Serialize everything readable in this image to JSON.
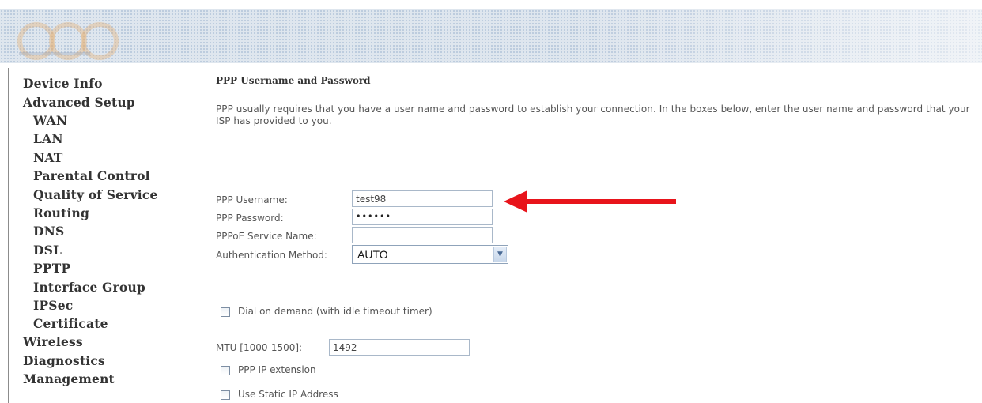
{
  "sidebar": {
    "items": [
      {
        "label": "Device Info",
        "sub": false
      },
      {
        "label": "Advanced Setup",
        "sub": false
      },
      {
        "label": "WAN",
        "sub": true
      },
      {
        "label": "LAN",
        "sub": true
      },
      {
        "label": "NAT",
        "sub": true
      },
      {
        "label": "Parental Control",
        "sub": true
      },
      {
        "label": "Quality of Service",
        "sub": true
      },
      {
        "label": "Routing",
        "sub": true
      },
      {
        "label": "DNS",
        "sub": true
      },
      {
        "label": "DSL",
        "sub": true
      },
      {
        "label": "PPTP",
        "sub": true
      },
      {
        "label": "Interface Group",
        "sub": true
      },
      {
        "label": "IPSec",
        "sub": true
      },
      {
        "label": "Certificate",
        "sub": true
      },
      {
        "label": "Wireless",
        "sub": false
      },
      {
        "label": "Diagnostics",
        "sub": false
      },
      {
        "label": "Management",
        "sub": false
      }
    ]
  },
  "main": {
    "title": "PPP Username and Password",
    "intro": "PPP usually requires that you have a user name and password to establish your connection. In the boxes below, enter the user name and password that your ISP has provided to you.",
    "fields": {
      "username_label": "PPP Username:",
      "username_value": "test98",
      "password_label": "PPP Password:",
      "password_value": "••••••",
      "service_label": "PPPoE Service Name:",
      "service_value": "",
      "auth_label": "Authentication Method:",
      "auth_value": "AUTO"
    },
    "dial_on_demand_label": "Dial on demand (with idle timeout timer)",
    "mtu_label": "MTU [1000-1500]:",
    "mtu_value": "1492",
    "ppp_ip_extension_label": "PPP IP extension",
    "static_ip_label": "Use Static IP Address"
  },
  "annotation": {
    "arrow_color": "#e8141b",
    "icon": "red-arrow-left-icon"
  },
  "icons": {
    "dropdown": "chevron-down-icon",
    "checkbox": "checkbox-icon"
  }
}
